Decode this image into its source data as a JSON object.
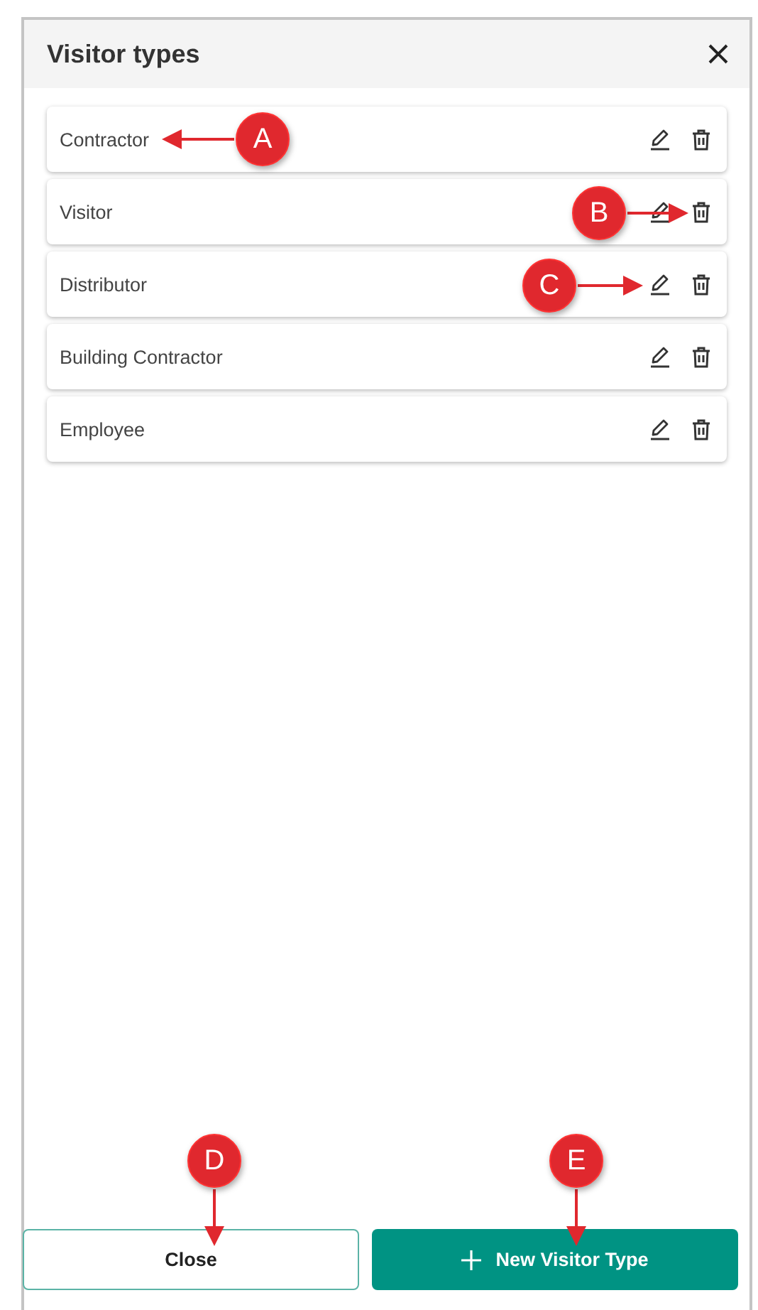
{
  "dialog": {
    "title": "Visitor types"
  },
  "items": [
    {
      "name": "Contractor"
    },
    {
      "name": "Visitor"
    },
    {
      "name": "Distributor"
    },
    {
      "name": "Building Contractor"
    },
    {
      "name": "Employee"
    }
  ],
  "buttons": [
    {
      "label": "Close",
      "kind": "secondary"
    },
    {
      "label": "New Visitor Type",
      "kind": "primary"
    }
  ],
  "callouts": [
    {
      "label": "A",
      "kind": "left"
    },
    {
      "label": "B",
      "kind": "right"
    },
    {
      "label": "C",
      "kind": "right"
    },
    {
      "label": "D",
      "kind": "down"
    },
    {
      "label": "E",
      "kind": "down"
    }
  ]
}
